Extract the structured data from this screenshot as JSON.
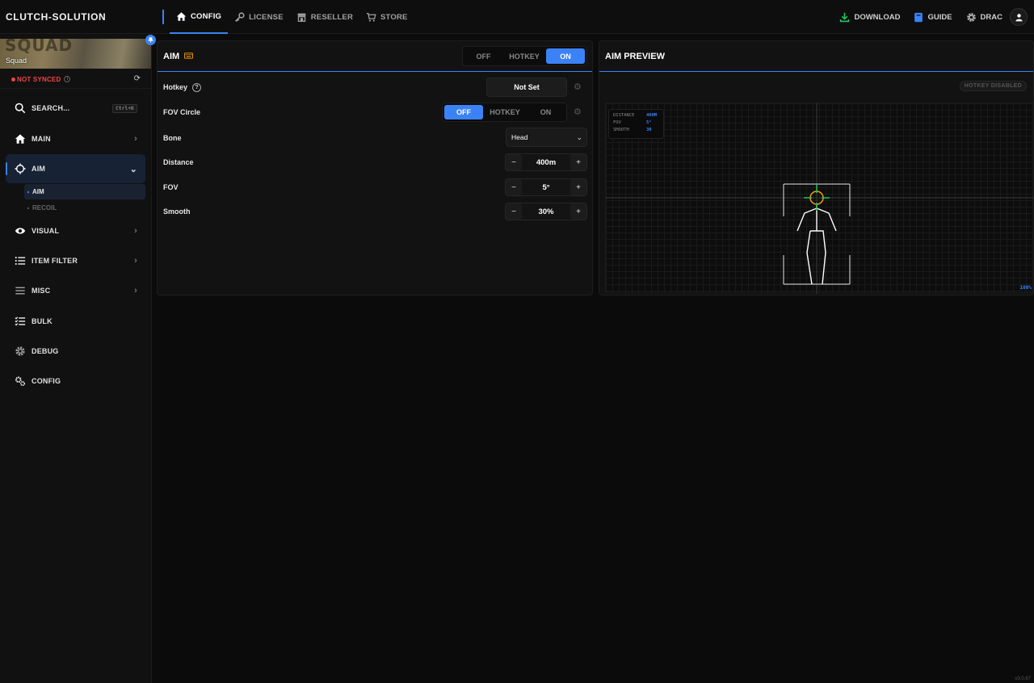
{
  "app": {
    "brand": "CLUTCH-SOLUTION",
    "version": "v3.0.67"
  },
  "nav": {
    "config": "CONFIG",
    "license": "LICENSE",
    "reseller": "RESELLER",
    "store": "STORE",
    "download": "DOWNLOAD",
    "guide": "GUIDE",
    "user": "DRAC"
  },
  "colors": {
    "accent": "#3b82f6",
    "danger": "#ef4444",
    "download": "#22c55e"
  },
  "sidebar": {
    "game_banner_word": "SQUAD",
    "game_name": "Squad",
    "sync_status": "NOT SYNCED",
    "search_label": "SEARCH...",
    "search_shortcut": "Ctrl+K",
    "items": [
      {
        "label": "MAIN",
        "icon": "home-icon"
      },
      {
        "label": "AIM",
        "icon": "crosshair-icon"
      },
      {
        "label": "VISUAL",
        "icon": "eye-icon"
      },
      {
        "label": "ITEM FILTER",
        "icon": "list-icon"
      },
      {
        "label": "MISC",
        "icon": "menu-icon"
      },
      {
        "label": "BULK",
        "icon": "checklist-icon"
      },
      {
        "label": "DEBUG",
        "icon": "gear-icon"
      },
      {
        "label": "CONFIG",
        "icon": "gears-icon"
      }
    ],
    "aim_subitems": [
      "AIM",
      "RECOIL"
    ]
  },
  "aim_panel": {
    "title": "AIM",
    "mode_options": [
      "OFF",
      "HOTKEY",
      "ON"
    ],
    "mode_selected": "ON",
    "rows": {
      "hotkey_label": "Hotkey",
      "hotkey_value": "Not Set",
      "fov_circle_label": "FOV Circle",
      "fov_circle_options": [
        "OFF",
        "HOTKEY",
        "ON"
      ],
      "fov_circle_selected": "OFF",
      "bone_label": "Bone",
      "bone_value": "Head",
      "distance_label": "Distance",
      "distance_value": "400m",
      "fov_label": "FOV",
      "fov_value": "5°",
      "smooth_label": "Smooth",
      "smooth_value": "30%"
    }
  },
  "preview_panel": {
    "title": "AIM PREVIEW",
    "hotkey_badge": "HOTKEY DISABLED",
    "info": {
      "distance_key": "DISTANCE",
      "distance_val": "400M",
      "fov_key": "FOV",
      "fov_val": "5°",
      "smooth_key": "SMOOTH",
      "smooth_val": "30"
    },
    "zoom": "100%"
  }
}
